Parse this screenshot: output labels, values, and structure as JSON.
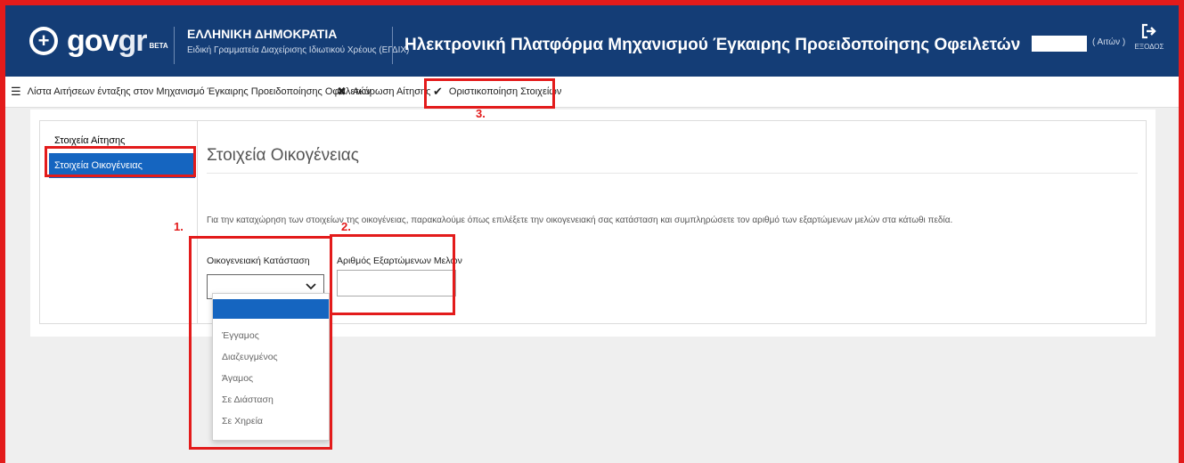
{
  "header": {
    "logo_text": "gov",
    "logo_text_accent": "gr",
    "logo_badge": "BETA",
    "org_title": "ΕΛΛΗΝΙΚΗ ΔΗΜΟΚΡΑΤΙΑ",
    "org_subtitle": "Ειδική Γραμματεία Διαχείρισης Ιδιωτικού Χρέους (ΕΓΔΙΧ)",
    "platform_title": "Ηλεκτρονική Πλατφόρμα Μηχανισμού Έγκαιρης Προειδοποίησης Οφειλετών",
    "user_role": "( Αιτών )",
    "logout_label": "ΕΞΟΔΟΣ",
    "logout_icon": "logout-icon"
  },
  "toolbar": {
    "list_label": "Λίστα Αιτήσεων ένταξης στον Μηχανισμό Έγκαιρης Προειδοποίησης Οφειλετών",
    "list_icon": "☰",
    "cancel_label": "Ακύρωση Αίτησης",
    "cancel_icon": "✖",
    "finalize_label": "Οριστικοποίηση Στοιχείων",
    "finalize_icon": "✔"
  },
  "sidebar": {
    "items": [
      {
        "label": "Στοιχεία Αίτησης",
        "active": false
      },
      {
        "label": "Στοιχεία Οικογένειας",
        "active": true
      }
    ]
  },
  "main": {
    "section_title": "Στοιχεία Οικογένειας",
    "description": "Για την καταχώρηση των στοιχείων της οικογένειας, παρακαλούμε όπως επιλέξετε την οικογενειακή σας κατάσταση και συμπληρώσετε τον αριθμό των εξαρτώμενων μελών στα κάτωθι πεδία.",
    "marital_label": "Οικογενειακή Κατάσταση",
    "marital_value": "",
    "dependents_label": "Αριθμός Εξαρτώμενων Μελών",
    "dependents_value": ""
  },
  "dropdown": {
    "options": [
      "",
      "Έγγαμος",
      "Διαζευγμένος",
      "Άγαμος",
      "Σε Διάσταση",
      "Σε Χηρεία"
    ],
    "selected_index": 0
  },
  "annotations": {
    "marker_1": "1.",
    "marker_2": "2.",
    "marker_3": "3.",
    "highlight_color": "#e31b1b"
  },
  "colors": {
    "header_bg": "#143d76",
    "accent": "#1565c0"
  }
}
